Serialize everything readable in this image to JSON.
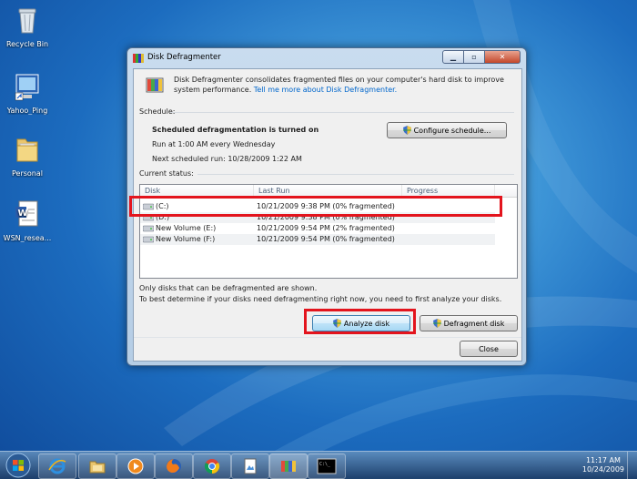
{
  "desktop": {
    "icons": [
      {
        "label": "Recycle Bin",
        "icon": "recycle-bin-icon"
      },
      {
        "label": "Yahoo_Ping",
        "icon": "shortcut-icon"
      },
      {
        "label": "Personal",
        "icon": "folder-icon"
      },
      {
        "label": "WSN_resea...",
        "icon": "document-icon"
      }
    ]
  },
  "window": {
    "title": "Disk Defragmenter",
    "description": "Disk Defragmenter consolidates fragmented files on your computer's hard disk to improve system performance.",
    "learn_more_link": "Tell me more about Disk Defragmenter.",
    "schedule_label": "Schedule:",
    "schedule_status": "Scheduled defragmentation is turned on",
    "schedule_run": "Run at 1:00 AM every Wednesday",
    "schedule_next": "Next scheduled run: 10/28/2009 1:22 AM",
    "configure_button": "Configure schedule...",
    "current_status_label": "Current status:",
    "columns": [
      "Disk",
      "Last Run",
      "Progress"
    ],
    "disks": [
      {
        "name": "(C:)",
        "last_run": "10/21/2009 9:38 PM (0% fragmented)"
      },
      {
        "name": "(D:)",
        "last_run": "10/21/2009 9:38 PM (0% fragmented)"
      },
      {
        "name": "New Volume (E:)",
        "last_run": "10/21/2009 9:54 PM (2% fragmented)"
      },
      {
        "name": "New Volume (F:)",
        "last_run": "10/21/2009 9:54 PM (0% fragmented)"
      }
    ],
    "note1": "Only disks that can be defragmented are shown.",
    "note2": "To best determine if your disks need defragmenting right now, you need to first analyze your disks.",
    "analyze_button": "Analyze disk",
    "defragment_button": "Defragment disk",
    "close_button": "Close"
  },
  "taskbar": {
    "time": "11:17 AM",
    "date": "10/24/2009",
    "apps": [
      "internet-explorer-icon",
      "explorer-folder-icon",
      "media-player-icon",
      "firefox-icon",
      "chrome-icon",
      "document-viewer-icon",
      "disk-defragmenter-icon",
      "command-prompt-icon"
    ]
  }
}
